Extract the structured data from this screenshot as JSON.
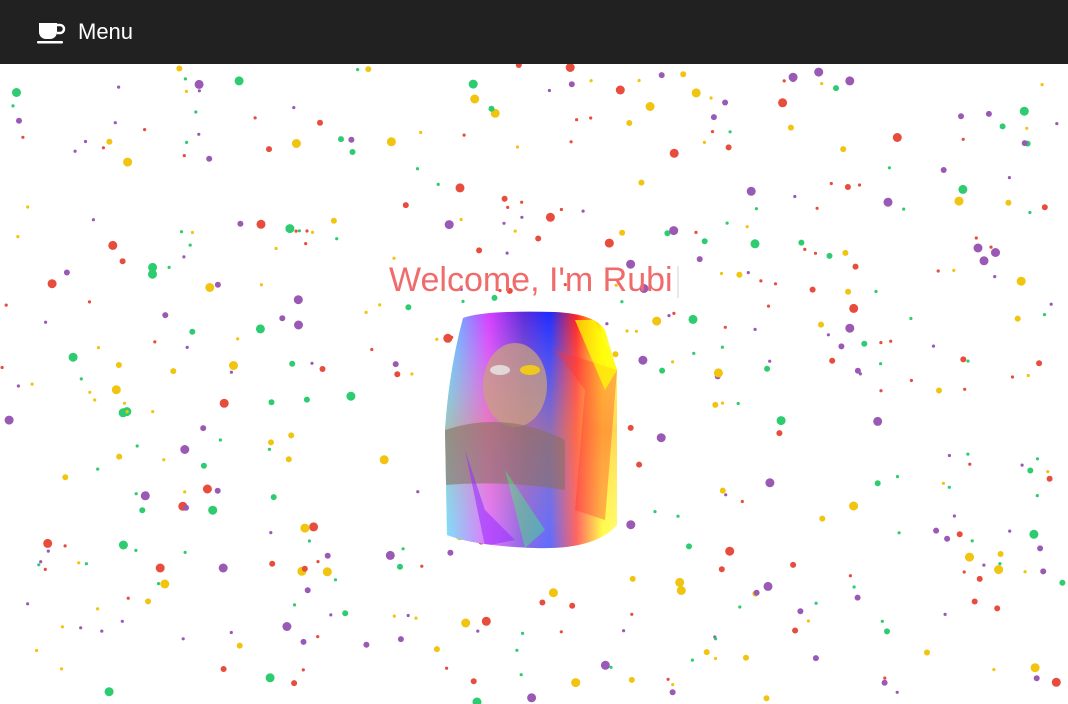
{
  "navbar": {
    "menu_label": "Menu",
    "menu_icon": "coffee-cup-icon",
    "background": "#212121"
  },
  "hero": {
    "title": "Welcome, I'm Rubi",
    "title_color": "#f06b6b"
  },
  "portrait": {
    "icon": "glitch-portrait-photo"
  },
  "confetti": {
    "colors": [
      "#e74c3c",
      "#f1c40f",
      "#2ecc71",
      "#9b59b6"
    ]
  }
}
